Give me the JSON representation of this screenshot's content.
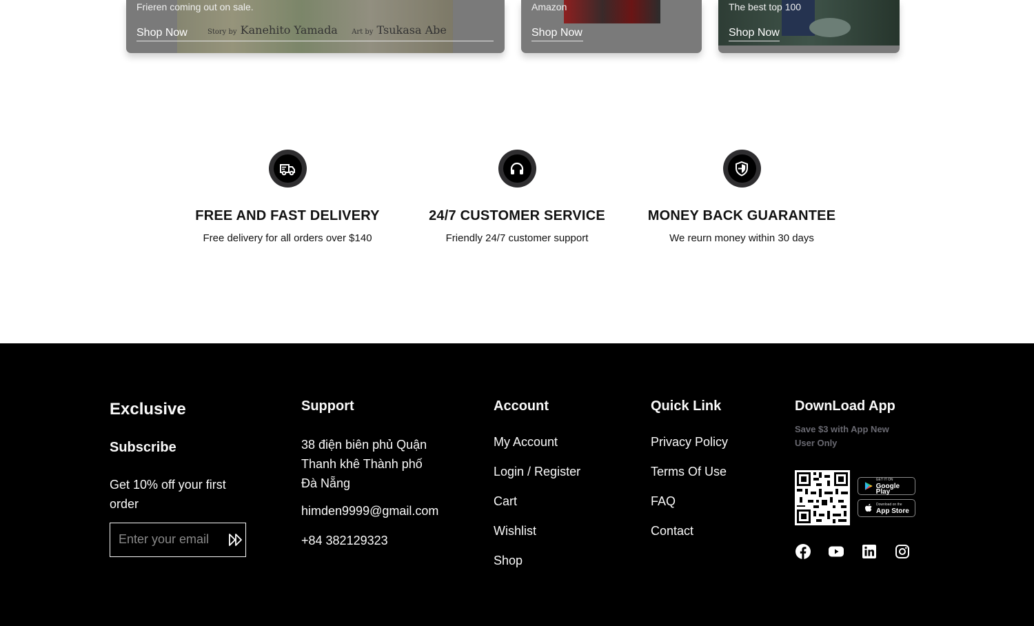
{
  "promo_cards": [
    {
      "text": "Frieren coming out on sale.",
      "art_story_prefix": "Story by",
      "art_story_author": "Kanehito Yamada",
      "art_art_prefix": "Art by",
      "art_art_author": "Tsukasa Abe",
      "shop_label": "Shop Now"
    },
    {
      "text": "Amazon",
      "shop_label": "Shop Now"
    },
    {
      "text": "The best top 100",
      "shop_label": "Shop Now"
    }
  ],
  "services": [
    {
      "icon": "delivery-truck-icon",
      "title": "FREE AND FAST DELIVERY",
      "subtitle": "Free delivery for all orders over $140"
    },
    {
      "icon": "headphones-icon",
      "title": "24/7 CUSTOMER SERVICE",
      "subtitle": "Friendly 24/7 customer support"
    },
    {
      "icon": "shield-icon",
      "title": "MONEY BACK GUARANTEE",
      "subtitle": "We reurn money within 30 days"
    }
  ],
  "footer": {
    "brand": "Exclusive",
    "subscribe_heading": "Subscribe",
    "subscribe_text": "Get 10% off your first order",
    "email_placeholder": "Enter your email",
    "support": {
      "heading": "Support",
      "address": "38 điện biên phủ Quận Thanh khê Thành phố Đà Nẵng",
      "email": "himden9999@gmail.com",
      "phone": "+84 382129323"
    },
    "account": {
      "heading": "Account",
      "items": [
        "My Account",
        "Login / Register",
        "Cart",
        "Wishlist",
        "Shop"
      ]
    },
    "quick_link": {
      "heading": "Quick Link",
      "items": [
        "Privacy Policy",
        "Terms Of Use",
        "FAQ",
        "Contact"
      ]
    },
    "download": {
      "heading": "DownLoad App",
      "promo": "Save $3 with App New User Only",
      "google_play_top": "GET IT ON",
      "google_play": "Google Play",
      "app_store_top": "Download on the",
      "app_store": "App Store",
      "socials": [
        "facebook-icon",
        "youtube-icon",
        "linkedin-icon",
        "instagram-icon"
      ]
    }
  }
}
